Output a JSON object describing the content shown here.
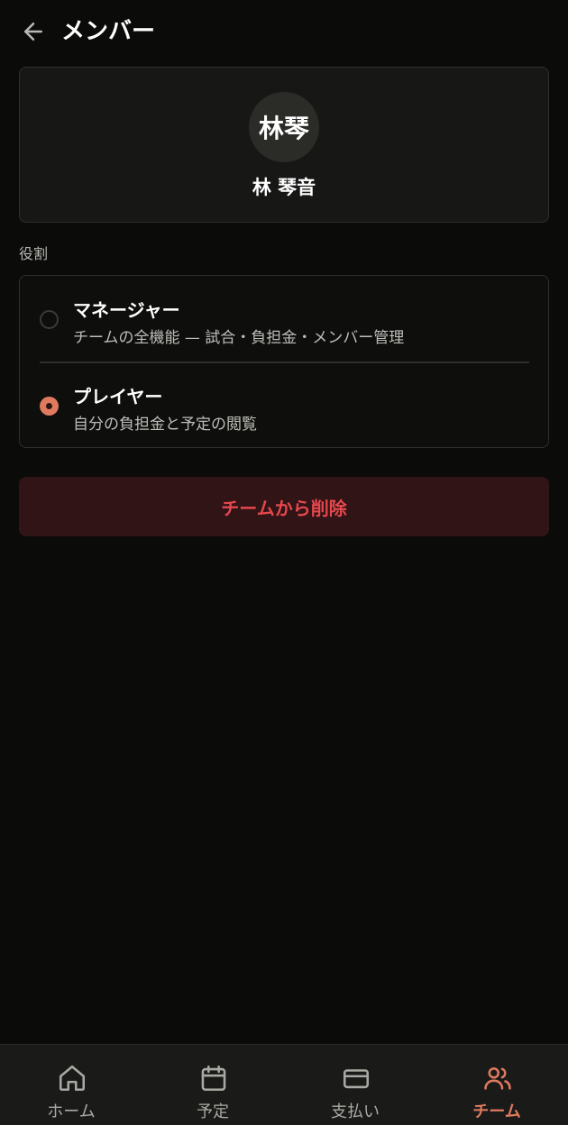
{
  "header": {
    "back_icon": "arrow-left-icon",
    "title": "メンバー"
  },
  "profile": {
    "avatar_text": "林琴",
    "name": "林 琴音"
  },
  "roles": {
    "section_label": "役割",
    "options": [
      {
        "title": "マネージャー",
        "description": "チームの全機能 — 試合・負担金・メンバー管理",
        "selected": false
      },
      {
        "title": "プレイヤー",
        "description": "自分の負担金と予定の閲覧",
        "selected": true
      }
    ]
  },
  "actions": {
    "remove_label": "チームから削除",
    "remove_color": "#e5484d"
  },
  "nav": {
    "items": [
      {
        "label": "ホーム",
        "icon": "home-icon",
        "active": false
      },
      {
        "label": "予定",
        "icon": "calendar-icon",
        "active": false
      },
      {
        "label": "支払い",
        "icon": "credit-card-icon",
        "active": false
      },
      {
        "label": "チーム",
        "icon": "users-icon",
        "active": true
      }
    ]
  },
  "colors": {
    "accent": "#e07a5f",
    "background": "#0b0b0a"
  }
}
